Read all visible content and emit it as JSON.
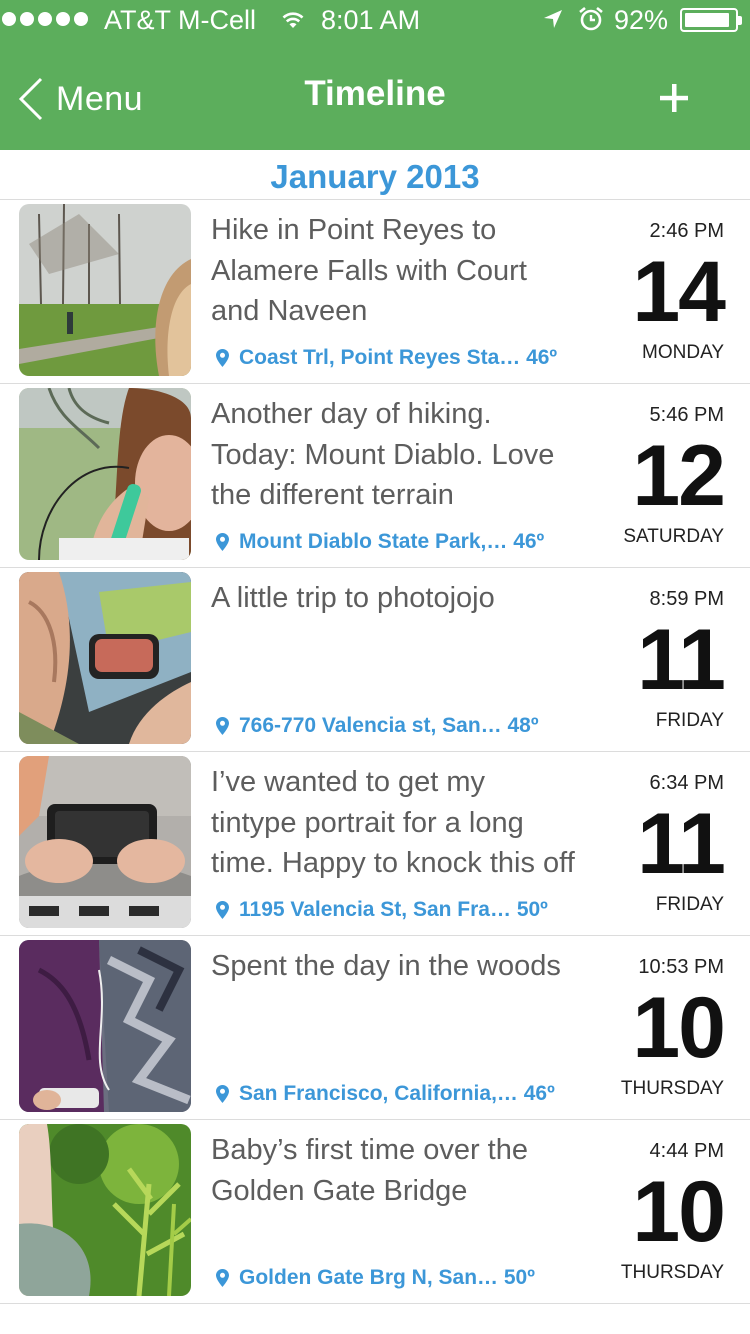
{
  "status_bar": {
    "carrier": "AT&T M-Cell",
    "time": "8:01 AM",
    "battery_pct": "92%",
    "battery_level": 0.92,
    "icons": [
      "signal-dots",
      "wifi-icon",
      "location-arrow-icon",
      "alarm-clock-icon",
      "battery-icon"
    ]
  },
  "nav": {
    "back_label": "Menu",
    "title": "Timeline",
    "add_icon": "plus-icon"
  },
  "colors": {
    "nav_green": "#5cae5c",
    "accent_blue": "#3c97d8",
    "body_text": "#5d5d5d"
  },
  "timeline": {
    "month": "January 2013",
    "entries": [
      {
        "text": "Hike in Point Reyes to Alamere Falls with Court and Naveen",
        "location": "Coast Trl, Point Reyes Sta… 46º",
        "time": "2:46 PM",
        "day": "14",
        "weekday": "MONDAY",
        "thumb": "park-path-photo"
      },
      {
        "text": "Another day of hiking. Today: Mount Diablo. Love the different terrain",
        "location": "Mount Diablo State Park,… 46º",
        "time": "5:46 PM",
        "day": "12",
        "weekday": "SATURDAY",
        "thumb": "woman-earbuds-photo"
      },
      {
        "text": "A little trip to photojojo",
        "location": "766-770 Valencia st, San… 48º",
        "time": "8:59 PM",
        "day": "11",
        "weekday": "FRIDAY",
        "thumb": "car-mirror-photo"
      },
      {
        "text": "I’ve wanted to get my tintype portrait for a long time. Happy to knock this off",
        "location": "1195 Valencia St, San Fra… 50º",
        "time": "6:34 PM",
        "day": "11",
        "weekday": "FRIDAY",
        "thumb": "hands-tintype-photo"
      },
      {
        "text": "Spent the day in the woods",
        "location": "San Francisco, California,… 46º",
        "time": "10:53 PM",
        "day": "10",
        "weekday": "THURSDAY",
        "thumb": "jackets-phone-photo"
      },
      {
        "text": "Baby’s first time over the Golden Gate Bridge",
        "location": "Golden Gate Brg N, San… 50º",
        "time": "4:44 PM",
        "day": "10",
        "weekday": "THURSDAY",
        "thumb": "green-plant-photo"
      }
    ]
  }
}
